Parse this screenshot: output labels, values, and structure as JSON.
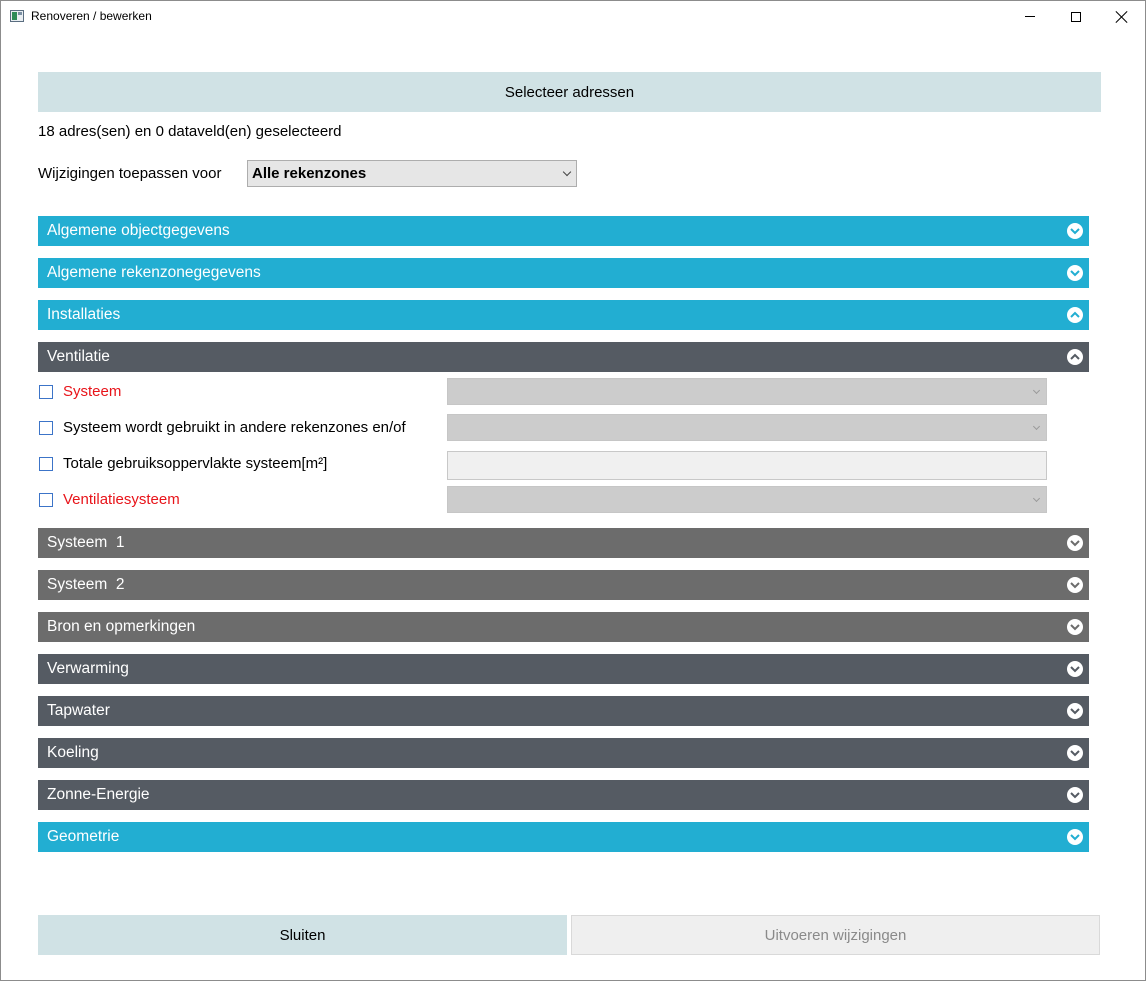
{
  "window": {
    "title": "Renoveren / bewerken"
  },
  "header": {
    "select_addresses_label": "Selecteer adressen",
    "summary": "18 adres(sen) en 0 dataveld(en) geselecteerd",
    "apply_label": "Wijzigingen toepassen voor",
    "zone_select_value": "Alle rekenzones"
  },
  "sections": {
    "algemene_object": {
      "label": "Algemene objectgegevens",
      "state": "collapsed",
      "icon": "chevron-down-icon"
    },
    "algemene_rekenzone": {
      "label": "Algemene rekenzonegegevens",
      "state": "collapsed",
      "icon": "chevron-down-icon"
    },
    "installaties": {
      "label": "Installaties",
      "state": "expanded",
      "icon": "chevron-up-icon"
    },
    "ventilatie": {
      "label": "Ventilatie",
      "state": "expanded",
      "icon": "chevron-up-icon"
    },
    "systeem1": {
      "label": "Systeem  1",
      "state": "collapsed",
      "icon": "chevron-down-icon"
    },
    "systeem2": {
      "label": "Systeem  2",
      "state": "collapsed",
      "icon": "chevron-down-icon"
    },
    "bron": {
      "label": "Bron en opmerkingen",
      "state": "collapsed",
      "icon": "chevron-down-icon"
    },
    "verwarming": {
      "label": "Verwarming",
      "state": "collapsed",
      "icon": "chevron-down-icon"
    },
    "tapwater": {
      "label": "Tapwater",
      "state": "collapsed",
      "icon": "chevron-down-icon"
    },
    "koeling": {
      "label": "Koeling",
      "state": "collapsed",
      "icon": "chevron-down-icon"
    },
    "zonne": {
      "label": "Zonne-Energie",
      "state": "collapsed",
      "icon": "chevron-down-icon"
    },
    "geometrie": {
      "label": "Geometrie",
      "state": "collapsed",
      "icon": "chevron-down-icon"
    }
  },
  "ventilatie_fields": {
    "systeem": {
      "label": "Systeem",
      "required": true,
      "checked": false,
      "value": ""
    },
    "gebruikt_andere": {
      "label": "Systeem wordt gebruikt in andere rekenzones en/of",
      "required": false,
      "checked": false,
      "value": ""
    },
    "gebruiksoppervlakte": {
      "label": "Totale gebruiksoppervlakte systeem[m²]",
      "required": false,
      "checked": false,
      "value": ""
    },
    "ventilatiesysteem": {
      "label": "Ventilatiesysteem",
      "required": true,
      "checked": false,
      "value": ""
    }
  },
  "footer": {
    "close_label": "Sluiten",
    "apply_label": "Uitvoeren wijzigingen"
  },
  "colors": {
    "section_blue": "#22aed2",
    "section_dark": "#555b63",
    "section_grey": "#6c6c6c",
    "button_bg": "#d0e2e5",
    "required_text": "#e8141a"
  }
}
